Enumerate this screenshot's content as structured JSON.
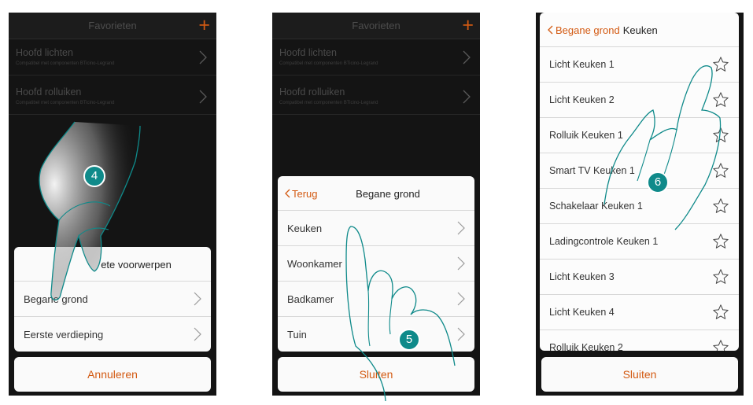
{
  "screen1": {
    "header_title": "Favorieten",
    "plus_icon": "+",
    "favorites": [
      {
        "name": "Hoofd lichten",
        "subtitle": "Compatibel met componenten BTicino-Legrand"
      },
      {
        "name": "Hoofd rolluiken",
        "subtitle": "Compatibel met componenten BTicino-Legrand"
      }
    ],
    "sheet_title_visible": "ete voorwerpen",
    "rows": [
      "Begane grond",
      "Eerste verdieping"
    ],
    "cancel_label": "Annuleren",
    "step": "4"
  },
  "screen2": {
    "header_title": "Favorieten",
    "plus_icon": "+",
    "favorites": [
      {
        "name": "Hoofd lichten",
        "subtitle": "Compatibel met componenten BTicino-Legrand"
      },
      {
        "name": "Hoofd rolluiken",
        "subtitle": "Compatibel met componenten BTicino-Legrand"
      }
    ],
    "back_label": "Terug",
    "sheet_title": "Begane grond",
    "rows": [
      "Keuken",
      "Woonkamer",
      "Badkamer",
      "Tuin"
    ],
    "close_label": "Sluiten",
    "step": "5"
  },
  "screen3": {
    "back_label": "Begane grond",
    "current_room": "Keuken",
    "items": [
      "Licht Keuken 1",
      "Licht Keuken 2",
      "Rolluik Keuken 1",
      "Smart TV Keuken 1",
      "Schakelaar Keuken 1",
      "Ladingcontrole Keuken 1",
      "Licht Keuken 3",
      "Licht Keuken 4",
      "Rolluik Keuken 2"
    ],
    "close_label": "Sluiten",
    "step": "6"
  },
  "colors": {
    "accent": "#d35a12",
    "badge": "#0f8a8a",
    "app_bg": "#141414",
    "sheet_bg": "#fafafa"
  },
  "icons": [
    "plus-icon",
    "chevron-right-icon",
    "chevron-left-icon",
    "star-outline-icon",
    "hand-pointer-icon"
  ]
}
